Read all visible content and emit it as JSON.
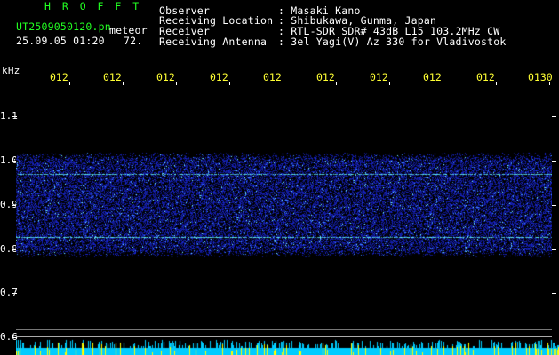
{
  "header": {
    "program_title": "H R O F F T",
    "filename": "UT2509050120.pn",
    "mode": "meteor",
    "datetime": "25.09.05 01:20",
    "count": "72.",
    "fields": [
      {
        "label": "Observer",
        "value": ": Masaki Kano"
      },
      {
        "label": "Receiving Location",
        "value": ": Shibukawa, Gunma, Japan"
      },
      {
        "label": "Receiver",
        "value": ": RTL-SDR SDR# 43dB L15 103.2MHz CW"
      },
      {
        "label": "Receiving Antenna",
        "value": ": 3el Yagi(V) Az 330 for Vladivostok"
      }
    ]
  },
  "axis": {
    "unit": "kHz",
    "y_ticks": [
      "1.1",
      "1.0",
      "0.9",
      "0.8",
      "0.7",
      "0.6"
    ],
    "x_ticks": [
      "012",
      "012",
      "012",
      "012",
      "012",
      "012",
      "012",
      "012",
      "012",
      "0130"
    ]
  },
  "colors": {
    "noise": "#1a2aff",
    "line": "#66ffff",
    "bar_cyan": "#00ccff",
    "bar_yellow": "#ffff00"
  }
}
